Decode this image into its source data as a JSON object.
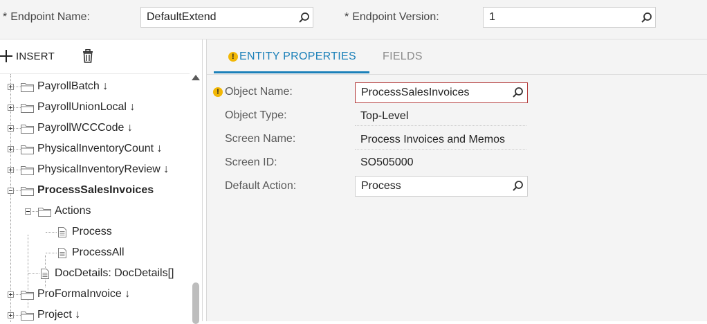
{
  "header": {
    "required_mark": "*",
    "endpoint_name_label": "Endpoint Name:",
    "endpoint_name_value": "DefaultExtend",
    "endpoint_version_label": "Endpoint Version:",
    "endpoint_version_value": "1"
  },
  "toolbar": {
    "insert_label": "INSERT"
  },
  "tree": {
    "items": [
      {
        "label": "PayrollBatch ↓"
      },
      {
        "label": "PayrollUnionLocal ↓"
      },
      {
        "label": "PayrollWCCCode ↓"
      },
      {
        "label": "PhysicalInventoryCount ↓"
      },
      {
        "label": "PhysicalInventoryReview ↓"
      },
      {
        "label": "ProcessSalesInvoices"
      },
      {
        "label": "Actions"
      },
      {
        "label": "Process"
      },
      {
        "label": "ProcessAll"
      },
      {
        "label": "DocDetails: DocDetails[]"
      },
      {
        "label": "ProFormaInvoice ↓"
      },
      {
        "label": "Project ↓"
      }
    ]
  },
  "tabs": {
    "entity_properties": "ENTITY PROPERTIES",
    "fields": "FIELDS",
    "warning_glyph": "!"
  },
  "properties": {
    "object_name_label": "Object Name:",
    "object_name_value": "ProcessSalesInvoices",
    "object_type_label": "Object Type:",
    "object_type_value": "Top-Level",
    "screen_name_label": "Screen Name:",
    "screen_name_value": "Process Invoices and Memos",
    "screen_id_label": "Screen ID:",
    "screen_id_value": "SO505000",
    "default_action_label": "Default Action:",
    "default_action_value": "Process"
  },
  "colors": {
    "accent": "#1b80b9",
    "warning": "#f2b705",
    "error_border": "#b33a3a"
  },
  "icons": [
    "search-icon",
    "plus-icon",
    "trash-icon",
    "folder-icon",
    "document-icon",
    "warning-icon",
    "scroll-up-icon"
  ]
}
